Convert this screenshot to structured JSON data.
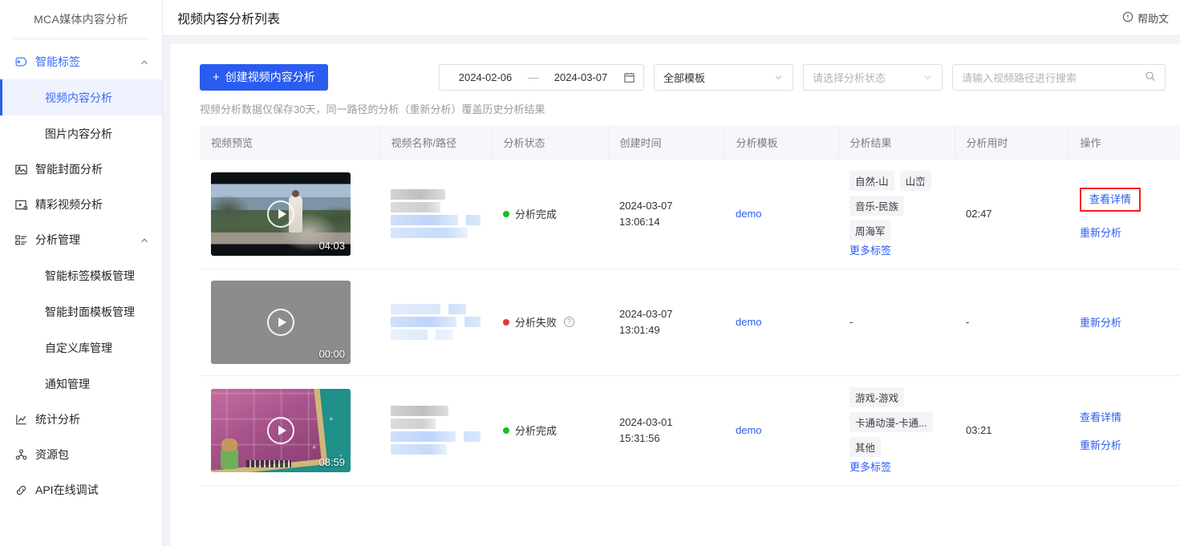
{
  "sidebar": {
    "brand": "MCA媒体内容分析",
    "groups": [
      {
        "label": "智能标签",
        "icon": "tag-icon",
        "expanded": true,
        "items": [
          {
            "label": "视频内容分析",
            "selected": true
          },
          {
            "label": "图片内容分析",
            "selected": false
          }
        ]
      }
    ],
    "single_items": [
      {
        "label": "智能封面分析",
        "icon": "image-icon"
      },
      {
        "label": "精彩视频分析",
        "icon": "video-icon"
      }
    ],
    "manage_group": {
      "label": "分析管理",
      "icon": "list-icon",
      "expanded": true,
      "items": [
        {
          "label": "智能标签模板管理"
        },
        {
          "label": "智能封面模板管理"
        },
        {
          "label": "自定义库管理"
        },
        {
          "label": "通知管理"
        }
      ]
    },
    "bottom_items": [
      {
        "label": "统计分析",
        "icon": "chart-icon"
      },
      {
        "label": "资源包",
        "icon": "package-icon"
      },
      {
        "label": "API在线调试",
        "icon": "link-icon"
      }
    ]
  },
  "header": {
    "title": "视频内容分析列表",
    "help_label": "帮助文",
    "help_icon": "info-circle-icon"
  },
  "toolbar": {
    "create_button": "创建视频内容分析",
    "create_icon": "plus-icon",
    "date_start": "2024-02-06",
    "date_separator": "—",
    "date_end": "2024-03-07",
    "calendar_icon": "calendar-icon",
    "template_select": "全部模板",
    "status_select_placeholder": "请选择分析状态",
    "search_placeholder": "请输入视频路径进行搜索",
    "search_icon": "search-icon",
    "chevron_icon": "chevron-down-icon"
  },
  "hint": "视频分析数据仅保存30天，同一路径的分析（重新分析）覆盖历史分析结果",
  "table": {
    "columns": [
      "视频预览",
      "视频名称/路径",
      "分析状态",
      "创建时间",
      "分析模板",
      "分析结果",
      "分析用时",
      "操作"
    ],
    "rows": [
      {
        "duration": "04:03",
        "thumb_style": "art-1",
        "status": "分析完成",
        "status_color": "#19be21",
        "status_has_help": false,
        "created_date": "2024-03-07",
        "created_time": "13:06:14",
        "template": "demo",
        "tags": [
          "自然-山",
          "山峦",
          "音乐-民族",
          "周海军"
        ],
        "more_tags": "更多标签",
        "elapsed": "02:47",
        "actions": [
          "查看详情",
          "重新分析"
        ],
        "highlight_action": "查看详情"
      },
      {
        "duration": "00:00",
        "thumb_style": "art-blank",
        "status": "分析失败",
        "status_color": "#e4393c",
        "status_has_help": true,
        "created_date": "2024-03-07",
        "created_time": "13:01:49",
        "template": "demo",
        "tags": [],
        "tags_empty": "-",
        "more_tags": "",
        "elapsed": "-",
        "actions": [
          "重新分析"
        ],
        "highlight_action": ""
      },
      {
        "duration": "08:59",
        "thumb_style": "art-3",
        "status": "分析完成",
        "status_color": "#19be21",
        "status_has_help": false,
        "created_date": "2024-03-01",
        "created_time": "15:31:56",
        "template": "demo",
        "tags": [
          "游戏-游戏",
          "卡通动漫-卡通...",
          "其他"
        ],
        "more_tags": "更多标签",
        "elapsed": "03:21",
        "actions": [
          "查看详情",
          "重新分析"
        ],
        "highlight_action": ""
      }
    ]
  },
  "colors": {
    "accent": "#2b5cf0",
    "sidebar_active_bg": "#eef3fe",
    "success": "#19be21",
    "danger": "#e4393c",
    "highlight_box": "#f91a1a"
  }
}
